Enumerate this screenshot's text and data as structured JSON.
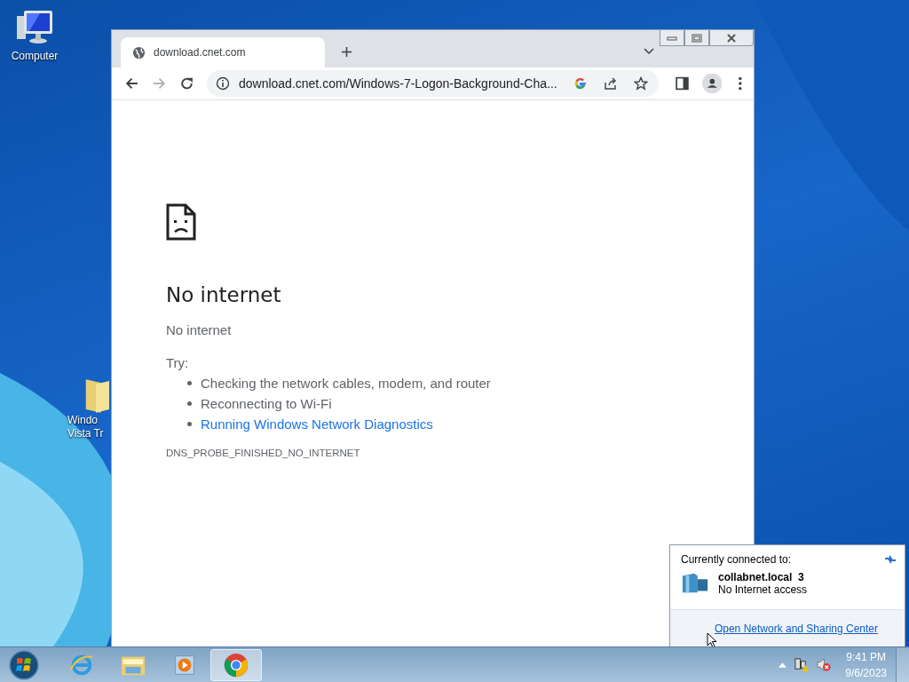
{
  "desktop_icons": [
    {
      "kind": "computer",
      "label": "Computer"
    },
    {
      "kind": "folder",
      "label": "Windo Vista Tr"
    }
  ],
  "browser": {
    "tab_title": "download.cnet.com",
    "url": "download.cnet.com/Windows-7-Logon-Background-Cha...",
    "page": {
      "heading": "No internet",
      "subtitle": "No internet",
      "try_label": "Try:",
      "suggestions": [
        {
          "kind": "text",
          "text": "Checking the network cables, modem, and router"
        },
        {
          "kind": "text",
          "text": "Reconnecting to Wi-Fi"
        },
        {
          "kind": "link",
          "text": "Running Windows Network Diagnostics"
        }
      ],
      "error_code": "DNS_PROBE_FINISHED_NO_INTERNET"
    }
  },
  "network_popup": {
    "heading": "Currently connected to:",
    "network_name": "collabnet.local  3",
    "status": "No Internet access",
    "link": "Open Network and Sharing Center"
  },
  "taskbar": {
    "items": [
      {
        "kind": "ie",
        "active": false
      },
      {
        "kind": "explorer",
        "active": false
      },
      {
        "kind": "media",
        "active": false
      },
      {
        "kind": "chrome",
        "active": true
      }
    ],
    "time": "9:41 PM",
    "date": "9/6/2023"
  }
}
